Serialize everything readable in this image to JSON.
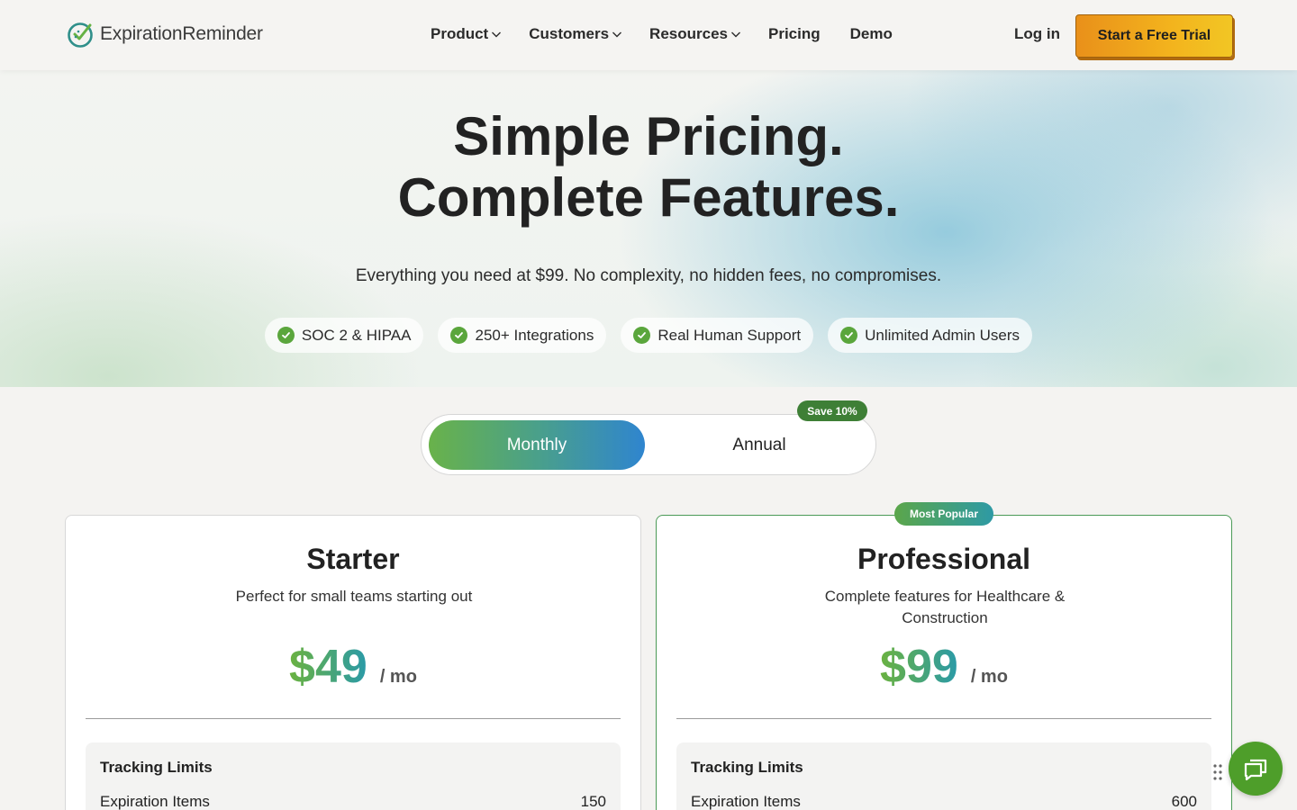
{
  "header": {
    "logo": {
      "part1": "Expiration",
      "part2": "Reminder",
      "icon": "clock-check-icon"
    },
    "nav": [
      {
        "label": "Product",
        "dropdown": true
      },
      {
        "label": "Customers",
        "dropdown": true
      },
      {
        "label": "Resources",
        "dropdown": true
      },
      {
        "label": "Pricing",
        "dropdown": false
      },
      {
        "label": "Demo",
        "dropdown": false
      }
    ],
    "login": "Log in",
    "cta": "Start a Free Trial"
  },
  "hero": {
    "title_line1": "Simple Pricing.",
    "title_line2": "Complete Features.",
    "subtitle": "Everything you need at $99. No complexity, no hidden fees, no compromises.",
    "badges": [
      "SOC 2 & HIPAA",
      "250+ Integrations",
      "Real Human Support",
      "Unlimited Admin Users"
    ]
  },
  "billing_toggle": {
    "monthly": "Monthly",
    "annual": "Annual",
    "save_badge": "Save 10%",
    "selected": "Monthly"
  },
  "plans": [
    {
      "name": "Starter",
      "description": "Perfect for small teams starting out",
      "price": "$49",
      "period": "/ mo",
      "limits_title": "Tracking Limits",
      "limit_label": "Expiration Items",
      "limit_value": "150"
    },
    {
      "name": "Professional",
      "description": "Complete features for Healthcare & Construction",
      "price": "$99",
      "period": "/ mo",
      "badge": "Most Popular",
      "limits_title": "Tracking Limits",
      "limit_label": "Expiration Items",
      "limit_value": "600"
    }
  ],
  "colors": {
    "accent_green": "#5aa63c",
    "cta_orange": "#e9901a",
    "toggle_blue": "#2f85cf",
    "popular_border": "#4b9a57"
  }
}
